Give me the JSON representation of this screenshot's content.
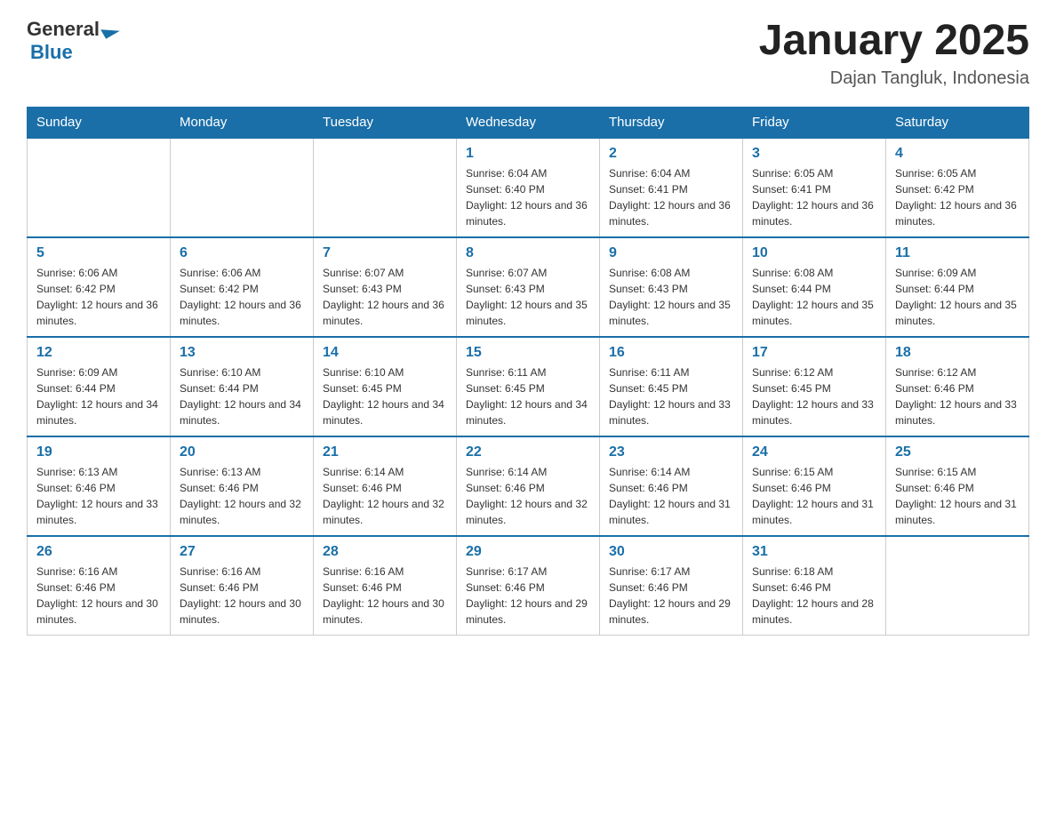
{
  "logo": {
    "text_general": "General",
    "text_blue": "Blue"
  },
  "header": {
    "month_title": "January 2025",
    "location": "Dajan Tangluk, Indonesia"
  },
  "weekdays": [
    "Sunday",
    "Monday",
    "Tuesday",
    "Wednesday",
    "Thursday",
    "Friday",
    "Saturday"
  ],
  "weeks": [
    [
      {
        "day": "",
        "info": ""
      },
      {
        "day": "",
        "info": ""
      },
      {
        "day": "",
        "info": ""
      },
      {
        "day": "1",
        "info": "Sunrise: 6:04 AM\nSunset: 6:40 PM\nDaylight: 12 hours and 36 minutes."
      },
      {
        "day": "2",
        "info": "Sunrise: 6:04 AM\nSunset: 6:41 PM\nDaylight: 12 hours and 36 minutes."
      },
      {
        "day": "3",
        "info": "Sunrise: 6:05 AM\nSunset: 6:41 PM\nDaylight: 12 hours and 36 minutes."
      },
      {
        "day": "4",
        "info": "Sunrise: 6:05 AM\nSunset: 6:42 PM\nDaylight: 12 hours and 36 minutes."
      }
    ],
    [
      {
        "day": "5",
        "info": "Sunrise: 6:06 AM\nSunset: 6:42 PM\nDaylight: 12 hours and 36 minutes."
      },
      {
        "day": "6",
        "info": "Sunrise: 6:06 AM\nSunset: 6:42 PM\nDaylight: 12 hours and 36 minutes."
      },
      {
        "day": "7",
        "info": "Sunrise: 6:07 AM\nSunset: 6:43 PM\nDaylight: 12 hours and 36 minutes."
      },
      {
        "day": "8",
        "info": "Sunrise: 6:07 AM\nSunset: 6:43 PM\nDaylight: 12 hours and 35 minutes."
      },
      {
        "day": "9",
        "info": "Sunrise: 6:08 AM\nSunset: 6:43 PM\nDaylight: 12 hours and 35 minutes."
      },
      {
        "day": "10",
        "info": "Sunrise: 6:08 AM\nSunset: 6:44 PM\nDaylight: 12 hours and 35 minutes."
      },
      {
        "day": "11",
        "info": "Sunrise: 6:09 AM\nSunset: 6:44 PM\nDaylight: 12 hours and 35 minutes."
      }
    ],
    [
      {
        "day": "12",
        "info": "Sunrise: 6:09 AM\nSunset: 6:44 PM\nDaylight: 12 hours and 34 minutes."
      },
      {
        "day": "13",
        "info": "Sunrise: 6:10 AM\nSunset: 6:44 PM\nDaylight: 12 hours and 34 minutes."
      },
      {
        "day": "14",
        "info": "Sunrise: 6:10 AM\nSunset: 6:45 PM\nDaylight: 12 hours and 34 minutes."
      },
      {
        "day": "15",
        "info": "Sunrise: 6:11 AM\nSunset: 6:45 PM\nDaylight: 12 hours and 34 minutes."
      },
      {
        "day": "16",
        "info": "Sunrise: 6:11 AM\nSunset: 6:45 PM\nDaylight: 12 hours and 33 minutes."
      },
      {
        "day": "17",
        "info": "Sunrise: 6:12 AM\nSunset: 6:45 PM\nDaylight: 12 hours and 33 minutes."
      },
      {
        "day": "18",
        "info": "Sunrise: 6:12 AM\nSunset: 6:46 PM\nDaylight: 12 hours and 33 minutes."
      }
    ],
    [
      {
        "day": "19",
        "info": "Sunrise: 6:13 AM\nSunset: 6:46 PM\nDaylight: 12 hours and 33 minutes."
      },
      {
        "day": "20",
        "info": "Sunrise: 6:13 AM\nSunset: 6:46 PM\nDaylight: 12 hours and 32 minutes."
      },
      {
        "day": "21",
        "info": "Sunrise: 6:14 AM\nSunset: 6:46 PM\nDaylight: 12 hours and 32 minutes."
      },
      {
        "day": "22",
        "info": "Sunrise: 6:14 AM\nSunset: 6:46 PM\nDaylight: 12 hours and 32 minutes."
      },
      {
        "day": "23",
        "info": "Sunrise: 6:14 AM\nSunset: 6:46 PM\nDaylight: 12 hours and 31 minutes."
      },
      {
        "day": "24",
        "info": "Sunrise: 6:15 AM\nSunset: 6:46 PM\nDaylight: 12 hours and 31 minutes."
      },
      {
        "day": "25",
        "info": "Sunrise: 6:15 AM\nSunset: 6:46 PM\nDaylight: 12 hours and 31 minutes."
      }
    ],
    [
      {
        "day": "26",
        "info": "Sunrise: 6:16 AM\nSunset: 6:46 PM\nDaylight: 12 hours and 30 minutes."
      },
      {
        "day": "27",
        "info": "Sunrise: 6:16 AM\nSunset: 6:46 PM\nDaylight: 12 hours and 30 minutes."
      },
      {
        "day": "28",
        "info": "Sunrise: 6:16 AM\nSunset: 6:46 PM\nDaylight: 12 hours and 30 minutes."
      },
      {
        "day": "29",
        "info": "Sunrise: 6:17 AM\nSunset: 6:46 PM\nDaylight: 12 hours and 29 minutes."
      },
      {
        "day": "30",
        "info": "Sunrise: 6:17 AM\nSunset: 6:46 PM\nDaylight: 12 hours and 29 minutes."
      },
      {
        "day": "31",
        "info": "Sunrise: 6:18 AM\nSunset: 6:46 PM\nDaylight: 12 hours and 28 minutes."
      },
      {
        "day": "",
        "info": ""
      }
    ]
  ]
}
